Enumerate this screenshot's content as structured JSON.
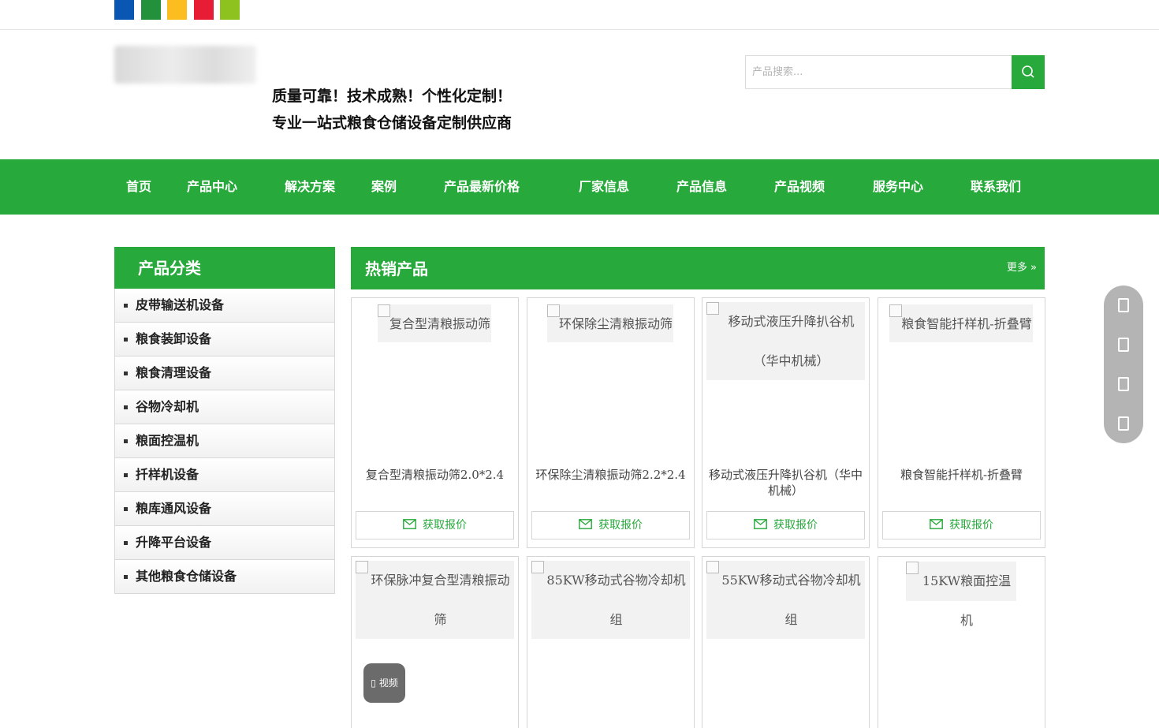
{
  "color_strip": [
    "#0a56b3",
    "#23913b",
    "#fcbd20",
    "#e61d34",
    "#8dc21f"
  ],
  "brand_color": "#27a93b",
  "header": {
    "slogan_line1": "质量可靠！技术成熟！个性化定制！",
    "slogan_line2": "专业一站式粮食仓储设备定制供应商",
    "search_placeholder": "产品搜索..."
  },
  "nav": [
    "首页",
    "产品中心",
    "解决方案",
    "案例",
    "产品最新价格",
    "厂家信息",
    "产品信息",
    "产品视频",
    "服务中心",
    "联系我们"
  ],
  "sidebar": {
    "title": "产品分类",
    "items": [
      "皮带输送机设备",
      "粮食装卸设备",
      "粮食清理设备",
      "谷物冷却机",
      "粮面控温机",
      "扦样机设备",
      "粮库通风设备",
      "升降平台设备",
      "其他粮食仓储设备"
    ]
  },
  "hot": {
    "title": "热销产品",
    "more": "更多 »",
    "quote_label": "获取报价",
    "products": [
      {
        "img_alt": "复合型清粮振动筛",
        "name": "复合型清粮振动筛2.0*2.4"
      },
      {
        "img_alt": "环保除尘清粮振动筛",
        "name": "环保除尘清粮振动筛2.2*2.4"
      },
      {
        "img_alt": "移动式液压升降扒谷机（华中机械）",
        "name": "移动式液压升降扒谷机（华中机械）"
      },
      {
        "img_alt": "粮食智能扦样机-折叠臂",
        "name": "粮食智能扦样机-折叠臂"
      },
      {
        "img_alt": "环保脉冲复合型清粮振动筛",
        "name": ""
      },
      {
        "img_alt": "85KW移动式谷物冷却机组",
        "name": ""
      },
      {
        "img_alt": "55KW移动式谷物冷却机组",
        "name": ""
      },
      {
        "img_alt": "15KW粮面控温机",
        "name": ""
      }
    ]
  },
  "float_icons": [
    "phone-icon",
    "chat-icon",
    "message-icon",
    "top-icon"
  ],
  "video_label": "视频"
}
